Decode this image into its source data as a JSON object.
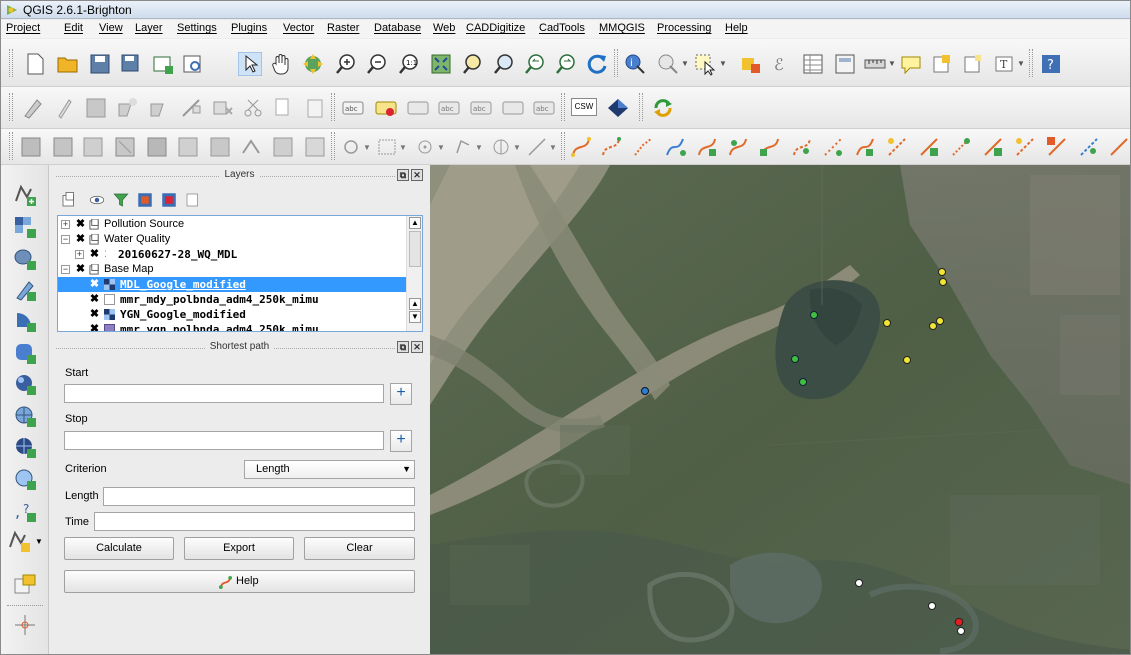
{
  "window": {
    "title": "QGIS 2.6.1-Brighton"
  },
  "menu": [
    "Project",
    "Edit",
    "View",
    "Layer",
    "Settings",
    "Plugins",
    "Vector",
    "Raster",
    "Database",
    "Web",
    "CADDigitize",
    "CadTools",
    "MMQGIS",
    "Processing",
    "Help"
  ],
  "label_toolbar": {
    "csw_label": "CSW"
  },
  "layers_panel": {
    "title": "Layers",
    "tree": [
      {
        "label": "Pollution Source",
        "bold": false
      },
      {
        "label": "Water Quality",
        "bold": false
      },
      {
        "label": "20160627-28_WQ_MDL",
        "bold": true
      },
      {
        "label": "Base Map",
        "bold": false
      },
      {
        "label": "MDL_Google_modified",
        "bold": true,
        "selected": true
      },
      {
        "label": "mmr_mdy_polbnda_adm4_250k_mimu",
        "bold": true
      },
      {
        "label": "YGN_Google_modified",
        "bold": true
      },
      {
        "label": "mmr_ygn_polbnda_adm4_250k_mimu",
        "bold": true
      }
    ]
  },
  "shortest_path": {
    "title": "Shortest path",
    "start_label": "Start",
    "start_value": "",
    "stop_label": "Stop",
    "stop_value": "",
    "criterion_label": "Criterion",
    "criterion_value": "Length",
    "length_label": "Length",
    "length_value": "",
    "time_label": "Time",
    "time_value": "",
    "calculate_label": "Calculate",
    "export_label": "Export",
    "clear_label": "Clear",
    "help_label": "Help"
  },
  "map": {
    "point_colors": {
      "green": "#3fbf3f",
      "yellow": "#f2e633",
      "white": "#ffffff",
      "red": "#e02020",
      "blue": "#2a7fd4"
    }
  }
}
